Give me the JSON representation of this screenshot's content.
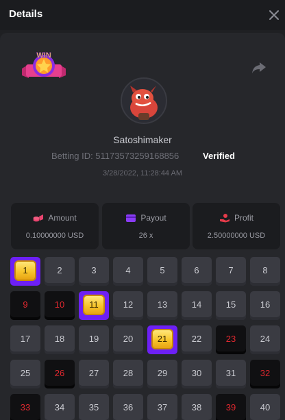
{
  "header": {
    "title": "Details"
  },
  "player": {
    "username": "Satoshimaker",
    "betting_id": "Betting ID: 51173573259168856",
    "verified": "Verified",
    "datetime": "3/28/2022, 11:28:44 AM",
    "badge_text": "WIN"
  },
  "stats": [
    {
      "label": "Amount",
      "value": "0.10000000 USD",
      "icon": "coins-icon"
    },
    {
      "label": "Payout",
      "value": "26 x",
      "icon": "wallet-icon"
    },
    {
      "label": "Profit",
      "value": "2.50000000 USD",
      "icon": "hand-coins-icon"
    }
  ],
  "colors": {
    "accent": "#6d20f5",
    "drawn_text": "#e0282f",
    "tile": "#3a3b42",
    "tile_drawn": "#101012"
  },
  "board": {
    "numbers": [
      1,
      2,
      3,
      4,
      5,
      6,
      7,
      8,
      9,
      10,
      11,
      12,
      13,
      14,
      15,
      16,
      17,
      18,
      19,
      20,
      21,
      22,
      23,
      24,
      25,
      26,
      27,
      28,
      29,
      30,
      31,
      32,
      33,
      34,
      35,
      36,
      37,
      38,
      39,
      40
    ],
    "hits": [
      1,
      11,
      21
    ],
    "drawn": [
      9,
      10,
      23,
      26,
      32,
      33,
      39
    ]
  }
}
